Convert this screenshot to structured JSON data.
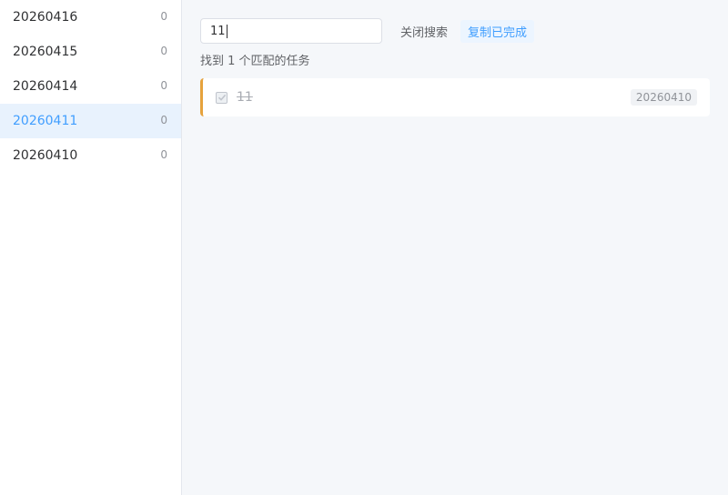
{
  "sidebar": {
    "items": [
      {
        "date": "20260416",
        "count": "0"
      },
      {
        "date": "20260415",
        "count": "0"
      },
      {
        "date": "20260414",
        "count": "0"
      },
      {
        "date": "20260411",
        "count": "0",
        "active": true
      },
      {
        "date": "20260410",
        "count": "0"
      }
    ]
  },
  "toolbar": {
    "search_value": "11",
    "close_search_label": "关闭搜索",
    "copy_done_label": "复制已完成"
  },
  "results": {
    "info": "找到 1 个匹配的任务",
    "tasks": [
      {
        "text": "11",
        "date": "20260410",
        "completed": true
      }
    ]
  },
  "colors": {
    "accent": "#409eff",
    "active_bg": "#e8f2fd",
    "task_border": "#e6a23c"
  }
}
